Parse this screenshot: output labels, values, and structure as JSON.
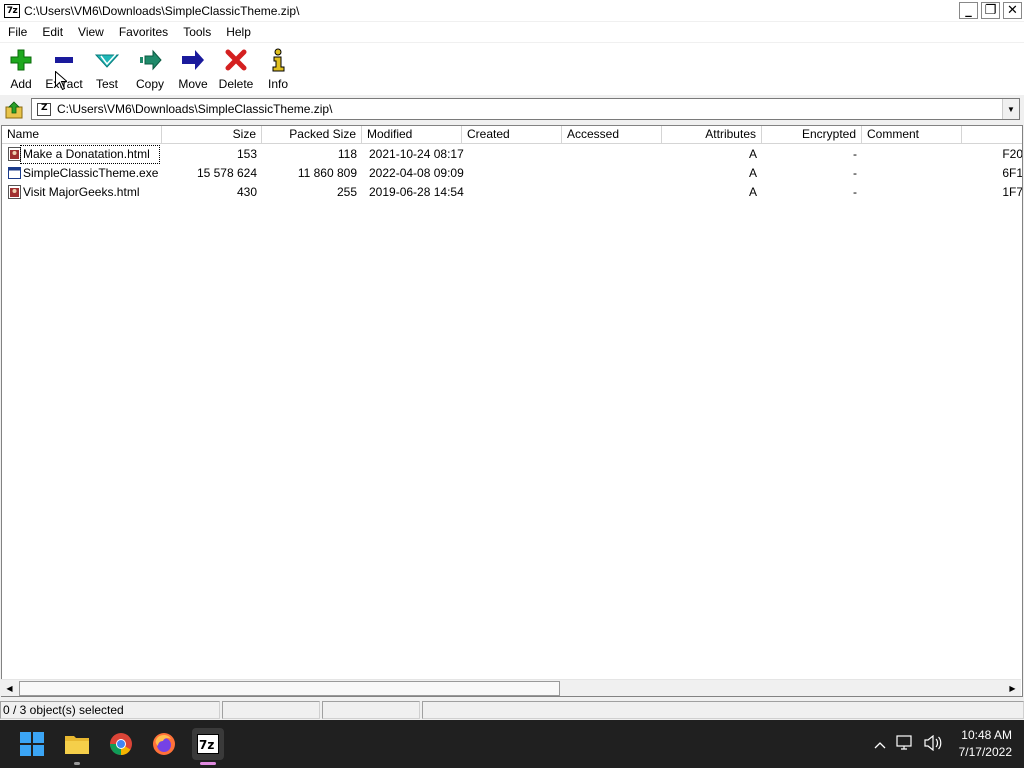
{
  "window": {
    "title": "C:\\Users\\VM6\\Downloads\\SimpleClassicTheme.zip\\",
    "app_icon_text": "7z",
    "controls": {
      "minimize": "_",
      "restore": "❐",
      "close": "✕"
    }
  },
  "menu": [
    "File",
    "Edit",
    "View",
    "Favorites",
    "Tools",
    "Help"
  ],
  "toolbar": {
    "add": "Add",
    "extract": "Extract",
    "test": "Test",
    "copy": "Copy",
    "move": "Move",
    "delete": "Delete",
    "info": "Info"
  },
  "address": {
    "path": "C:\\Users\\VM6\\Downloads\\SimpleClassicTheme.zip\\"
  },
  "columns": [
    "Name",
    "Size",
    "Packed Size",
    "Modified",
    "Created",
    "Accessed",
    "Attributes",
    "Encrypted",
    "Comment"
  ],
  "files": [
    {
      "name": "Make a Donatation.html",
      "size": "153",
      "packed": "118",
      "modified": "2021-10-24 08:17",
      "created": "",
      "accessed": "",
      "attributes": "A",
      "encrypted": "-",
      "comment": "",
      "crc": "F20"
    },
    {
      "name": "SimpleClassicTheme.exe",
      "size": "15 578 624",
      "packed": "11 860 809",
      "modified": "2022-04-08 09:09",
      "created": "",
      "accessed": "",
      "attributes": "A",
      "encrypted": "-",
      "comment": "",
      "crc": "6F1"
    },
    {
      "name": "Visit MajorGeeks.html",
      "size": "430",
      "packed": "255",
      "modified": "2019-06-28 14:54",
      "created": "",
      "accessed": "",
      "attributes": "A",
      "encrypted": "-",
      "comment": "",
      "crc": "1F7"
    }
  ],
  "status": {
    "selection": "0 / 3 object(s) selected"
  },
  "taskbar": {
    "apps": [
      "start-icon",
      "file-explorer-icon",
      "chrome-icon",
      "firefox-icon",
      "7zip-icon"
    ],
    "time": "10:48 AM",
    "date": "7/17/2022"
  },
  "colors": {
    "add": "#1fa81f",
    "extract": "#1a1a9c",
    "test": "#1fb8b8",
    "copy": "#1f8a6a",
    "move": "#1a1a9c",
    "delete": "#d42020",
    "info": "#e0c020"
  }
}
